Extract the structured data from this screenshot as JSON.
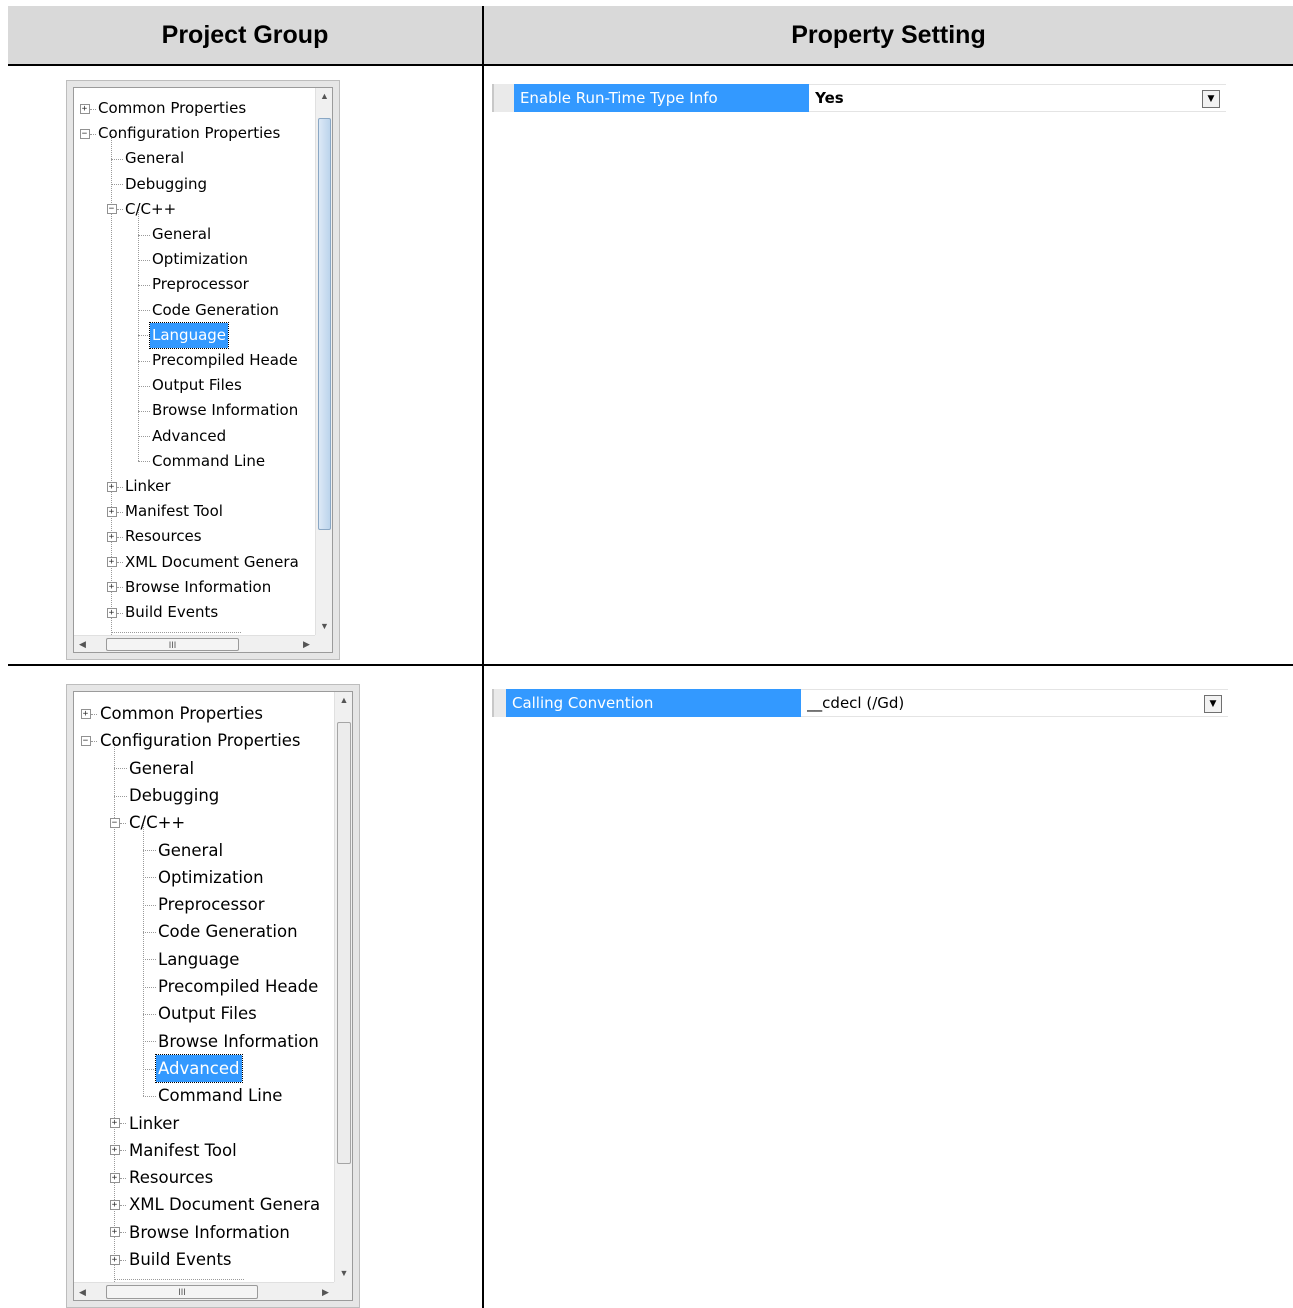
{
  "table": {
    "col_left_header": "Project Group",
    "col_right_header": "Property Setting"
  },
  "rows": [
    {
      "tree": {
        "items": [
          "Common Properties",
          "Configuration Properties",
          "General",
          "Debugging",
          "C/C++",
          "General",
          "Optimization",
          "Preprocessor",
          "Code Generation",
          "Language",
          "Precompiled Heade",
          "Output Files",
          "Browse Information",
          "Advanced",
          "Command Line",
          "Linker",
          "Manifest Tool",
          "Resources",
          "XML Document Genera",
          "Browse Information",
          "Build Events"
        ],
        "selected": "Language",
        "hscroll_thumb": "III"
      },
      "property": {
        "name": "Enable Run-Time Type Info",
        "value": "Yes"
      }
    },
    {
      "tree": {
        "items": [
          "Common Properties",
          "Configuration Properties",
          "General",
          "Debugging",
          "C/C++",
          "General",
          "Optimization",
          "Preprocessor",
          "Code Generation",
          "Language",
          "Precompiled Heade",
          "Output Files",
          "Browse Information",
          "Advanced",
          "Command Line",
          "Linker",
          "Manifest Tool",
          "Resources",
          "XML Document Genera",
          "Browse Information",
          "Build Events"
        ],
        "selected": "Advanced",
        "hscroll_thumb": "III"
      },
      "property": {
        "name": "Calling Convention",
        "value": "__cdecl (/Gd)"
      }
    }
  ],
  "icons": {
    "expand": "plus-box-icon",
    "collapse": "minus-box-icon",
    "dropdown": "chevron-down-icon"
  },
  "colors": {
    "selection": "#3399ff",
    "header_bg": "#d9d9d9"
  }
}
